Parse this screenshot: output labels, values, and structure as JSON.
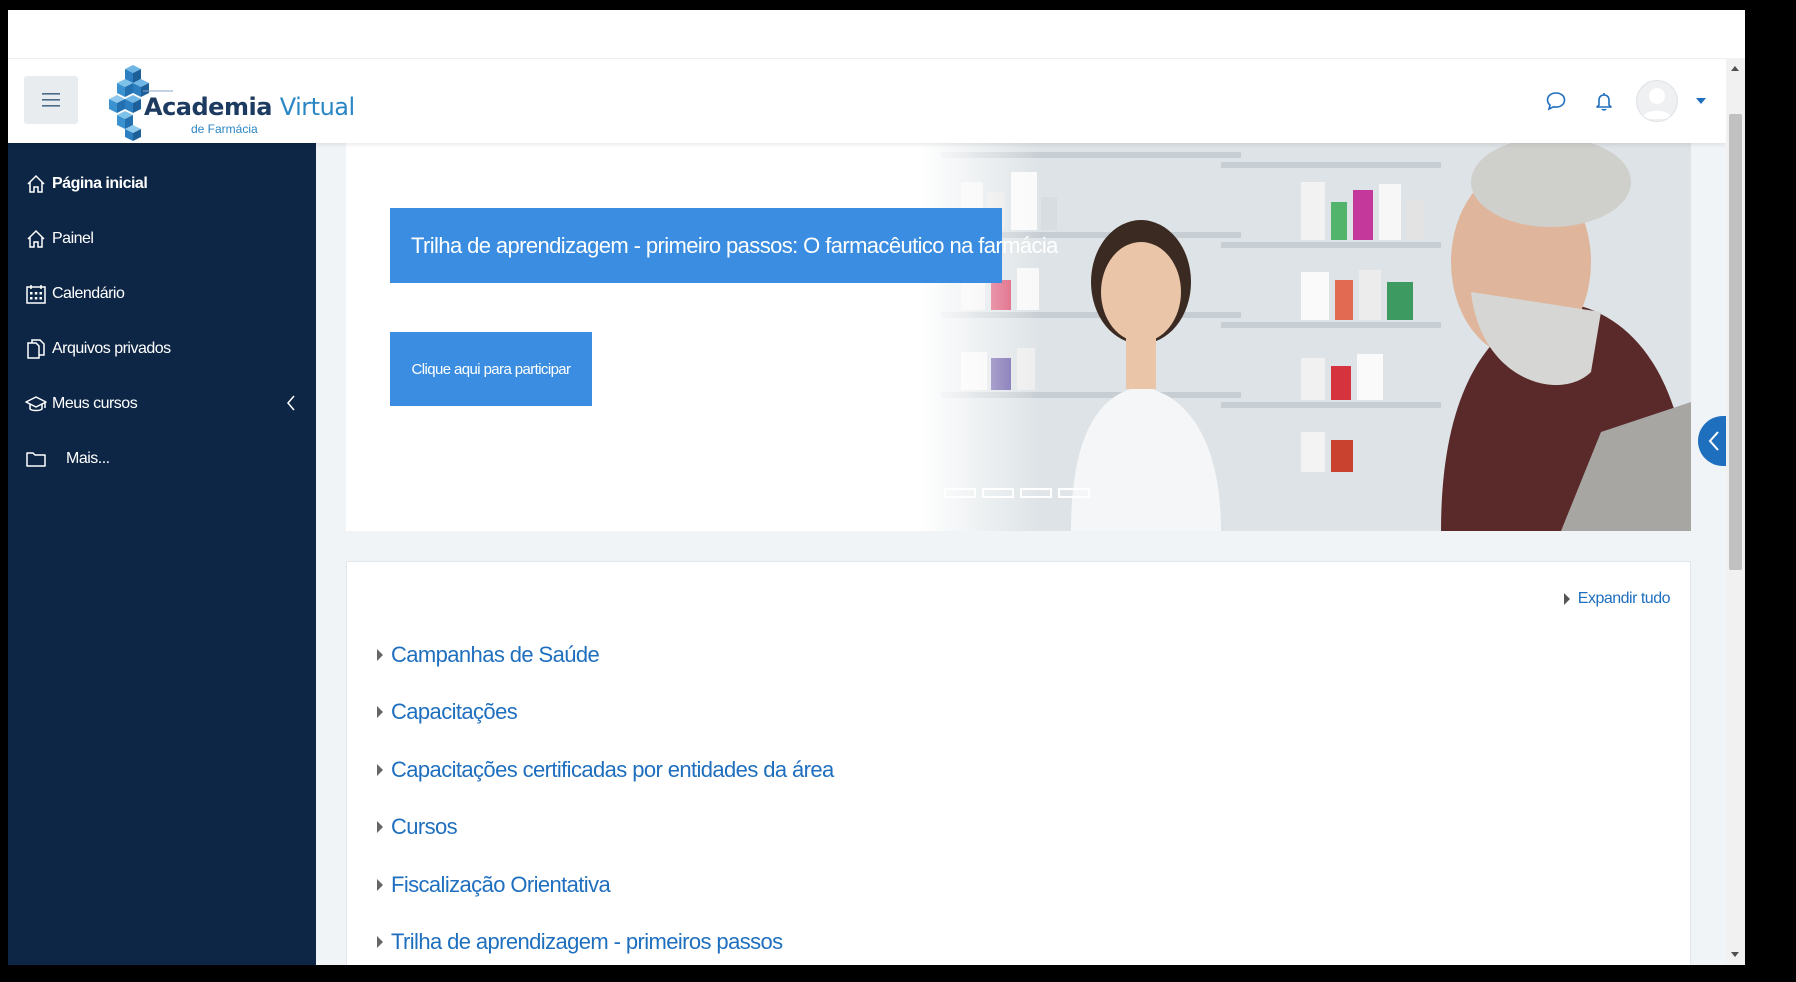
{
  "brand": {
    "logo_main": "Academia ",
    "logo_accent": "Virtual",
    "logo_sub": "de Farmácia"
  },
  "navbar": {
    "menu_icon": "hamburger-icon",
    "message_icon": "chat-bubble-icon",
    "notification_icon": "bell-icon",
    "user_icon": "avatar-icon"
  },
  "sidebar": {
    "items": [
      {
        "label": "Página inicial",
        "icon": "home-icon",
        "active": true
      },
      {
        "label": "Painel",
        "icon": "home-icon"
      },
      {
        "label": "Calendário",
        "icon": "calendar-icon"
      },
      {
        "label": "Arquivos privados",
        "icon": "file-icon"
      },
      {
        "label": "Meus cursos",
        "icon": "graduation-cap-icon"
      },
      {
        "label": "Mais...",
        "icon": "folder-icon"
      }
    ]
  },
  "hero": {
    "title": "Trilha de aprendizagem - primeiro passos: O farmacêutico na farmácia",
    "cta": "Clique aqui para participar",
    "slide_count": 4
  },
  "categories": {
    "expand_all": "Expandir tudo",
    "items": [
      "Campanhas de Saúde",
      "Capacitações",
      "Capacitações certificadas por entidades da área",
      "Cursos",
      "Fiscalização Orientativa",
      "Trilha de aprendizagem - primeiros passos"
    ]
  },
  "colors": {
    "sidebar_bg": "#0d2645",
    "accent": "#3a8de0",
    "link": "#1f6fbf"
  }
}
